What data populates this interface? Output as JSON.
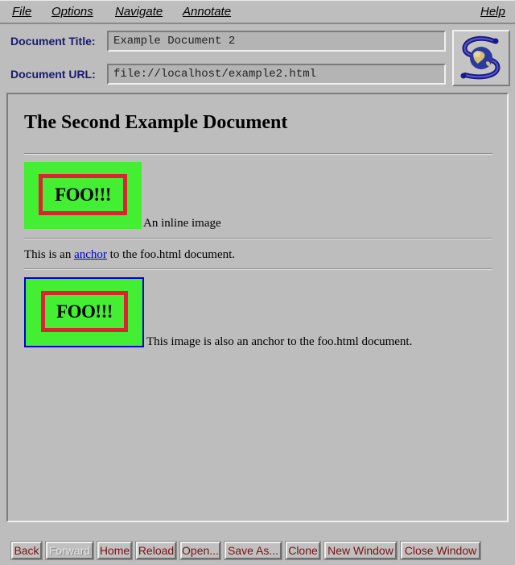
{
  "menubar": {
    "items": [
      {
        "label": "File"
      },
      {
        "label": "Options"
      },
      {
        "label": "Navigate"
      },
      {
        "label": "Annotate"
      },
      {
        "label": "Help"
      }
    ]
  },
  "header": {
    "title_label": "Document Title:",
    "title_value": "Example Document 2",
    "url_label": "Document URL:",
    "url_value": "file://localhost/example2.html",
    "logo_icon": "spinning-globe-s-logo-icon"
  },
  "document": {
    "heading": "The Second Example Document",
    "image1_text": "FOO!!!",
    "image1_caption": "An inline image",
    "anchor_prefix": "This is an",
    "anchor_link": "anchor",
    "anchor_suffix": "to the foo.html document.",
    "image2_text": "FOO!!!",
    "image2_caption": "This image is also an anchor to the foo.html document."
  },
  "buttons": {
    "back": "Back",
    "forward": "Forward",
    "home": "Home",
    "reload": "Reload",
    "open": "Open...",
    "save_as": "Save As...",
    "clone": "Clone",
    "new_window": "New Window",
    "close_window": "Close Window"
  },
  "colors": {
    "foo_background": "#44ee33",
    "foo_border": "#dd2233",
    "link": "#0000cc",
    "button_text": "#7a1010"
  }
}
